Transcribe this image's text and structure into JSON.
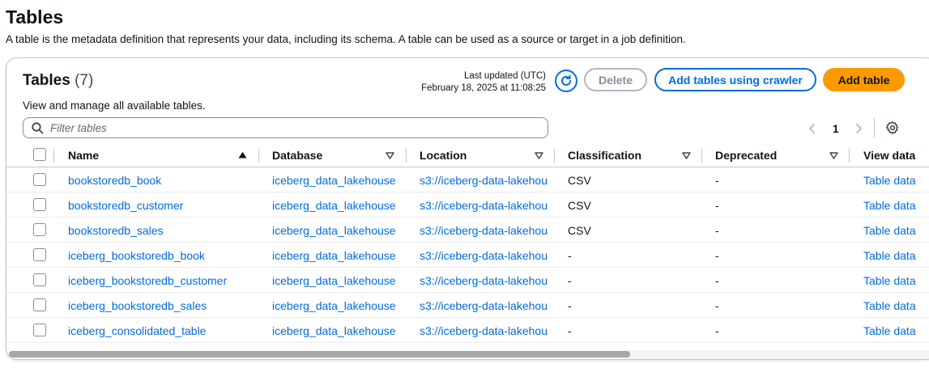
{
  "page": {
    "title": "Tables",
    "description": "A table is the metadata definition that represents your data, including its schema. A table can be used as a source or target in a job definition."
  },
  "panel": {
    "title": "Tables",
    "count": "(7)",
    "description": "View and manage all available tables.",
    "last_updated_label": "Last updated (UTC)",
    "last_updated_value": "February 18, 2025 at 11:08:25",
    "refresh_icon": "refresh-icon",
    "buttons": {
      "delete": "Delete",
      "crawler": "Add tables using crawler",
      "add": "Add table"
    },
    "filter": {
      "placeholder": "Filter tables",
      "value": ""
    },
    "pagination": {
      "current_page": "1"
    },
    "colors": {
      "link": "#006ce0",
      "primary": "#ff9900",
      "border": "#c6c6cd"
    }
  },
  "table": {
    "columns": [
      "Name",
      "Database",
      "Location",
      "Classification",
      "Deprecated",
      "View data"
    ],
    "rows": [
      {
        "name": "bookstoredb_book",
        "database": "iceberg_data_lakehouse",
        "location": "s3://iceberg-data-lakehou",
        "classification": "CSV",
        "deprecated": "-",
        "view": "Table data"
      },
      {
        "name": "bookstoredb_customer",
        "database": "iceberg_data_lakehouse",
        "location": "s3://iceberg-data-lakehou",
        "classification": "CSV",
        "deprecated": "-",
        "view": "Table data"
      },
      {
        "name": "bookstoredb_sales",
        "database": "iceberg_data_lakehouse",
        "location": "s3://iceberg-data-lakehou",
        "classification": "CSV",
        "deprecated": "-",
        "view": "Table data"
      },
      {
        "name": "iceberg_bookstoredb_book",
        "database": "iceberg_data_lakehouse",
        "location": "s3://iceberg-data-lakehou",
        "classification": "-",
        "deprecated": "-",
        "view": "Table data"
      },
      {
        "name": "iceberg_bookstoredb_customer",
        "database": "iceberg_data_lakehouse",
        "location": "s3://iceberg-data-lakehou",
        "classification": "-",
        "deprecated": "-",
        "view": "Table data"
      },
      {
        "name": "iceberg_bookstoredb_sales",
        "database": "iceberg_data_lakehouse",
        "location": "s3://iceberg-data-lakehou",
        "classification": "-",
        "deprecated": "-",
        "view": "Table data"
      },
      {
        "name": "iceberg_consolidated_table",
        "database": "iceberg_data_lakehouse",
        "location": "s3://iceberg-data-lakehou",
        "classification": "-",
        "deprecated": "-",
        "view": "Table data"
      }
    ]
  }
}
